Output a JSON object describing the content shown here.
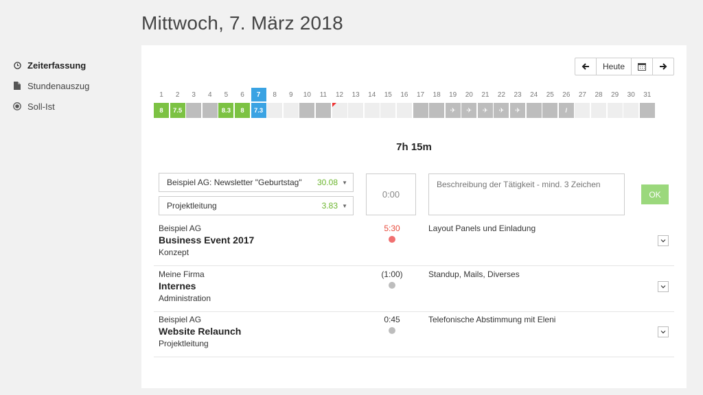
{
  "header": {
    "title": "Mittwoch, 7. März 2018"
  },
  "sidebar": {
    "items": [
      {
        "label": "Zeiterfassung",
        "icon": "clock-icon",
        "active": true
      },
      {
        "label": "Stundenauszug",
        "icon": "document-icon",
        "active": false
      },
      {
        "label": "Soll-Ist",
        "icon": "target-icon",
        "active": false
      }
    ]
  },
  "nav": {
    "today_label": "Heute"
  },
  "month": {
    "days": [
      {
        "n": "1",
        "v": "8",
        "t": "green"
      },
      {
        "n": "2",
        "v": "7.5",
        "t": "green"
      },
      {
        "n": "3",
        "v": "",
        "t": "gray"
      },
      {
        "n": "4",
        "v": "",
        "t": "gray"
      },
      {
        "n": "5",
        "v": "8.3",
        "t": "green"
      },
      {
        "n": "6",
        "v": "8",
        "t": "green"
      },
      {
        "n": "7",
        "v": "7.3",
        "t": "blue",
        "sel": true
      },
      {
        "n": "8",
        "v": "",
        "t": "empty"
      },
      {
        "n": "9",
        "v": "",
        "t": "empty"
      },
      {
        "n": "10",
        "v": "",
        "t": "gray"
      },
      {
        "n": "11",
        "v": "",
        "t": "gray"
      },
      {
        "n": "12",
        "v": "",
        "t": "empty",
        "flag": true
      },
      {
        "n": "13",
        "v": "",
        "t": "empty"
      },
      {
        "n": "14",
        "v": "",
        "t": "empty"
      },
      {
        "n": "15",
        "v": "",
        "t": "empty"
      },
      {
        "n": "16",
        "v": "",
        "t": "empty"
      },
      {
        "n": "17",
        "v": "",
        "t": "gray"
      },
      {
        "n": "18",
        "v": "",
        "t": "gray"
      },
      {
        "n": "19",
        "v": "✈",
        "t": "gray"
      },
      {
        "n": "20",
        "v": "✈",
        "t": "gray"
      },
      {
        "n": "21",
        "v": "✈",
        "t": "gray"
      },
      {
        "n": "22",
        "v": "✈",
        "t": "gray"
      },
      {
        "n": "23",
        "v": "✈",
        "t": "gray"
      },
      {
        "n": "24",
        "v": "",
        "t": "gray"
      },
      {
        "n": "25",
        "v": "",
        "t": "gray"
      },
      {
        "n": "26",
        "v": "/",
        "t": "gray"
      },
      {
        "n": "27",
        "v": "",
        "t": "empty"
      },
      {
        "n": "28",
        "v": "",
        "t": "empty"
      },
      {
        "n": "29",
        "v": "",
        "t": "empty"
      },
      {
        "n": "30",
        "v": "",
        "t": "empty"
      },
      {
        "n": "31",
        "v": "",
        "t": "gray"
      }
    ]
  },
  "total": "7h 15m",
  "form": {
    "project_select": {
      "label": "Beispiel AG: Newsletter \"Geburtstag\"",
      "value": "30.08"
    },
    "task_select": {
      "label": "Projektleitung",
      "value": "3.83"
    },
    "time": "0:00",
    "description_placeholder": "Beschreibung der Tätigkeit - mind. 3 Zeichen",
    "ok_label": "OK"
  },
  "entries": [
    {
      "client": "Beispiel AG",
      "project": "Business Event 2017",
      "task": "Konzept",
      "time": "5:30",
      "status": "red",
      "description": "Layout Panels und Einladung"
    },
    {
      "client": "Meine Firma",
      "project": "Internes",
      "task": "Administration",
      "time": "(1:00)",
      "status": "gray",
      "description": "Standup, Mails, Diverses"
    },
    {
      "client": "Beispiel AG",
      "project": "Website Relaunch",
      "task": "Projektleitung",
      "time": "0:45",
      "status": "gray",
      "description": "Telefonische Abstimmung mit Eleni"
    }
  ]
}
